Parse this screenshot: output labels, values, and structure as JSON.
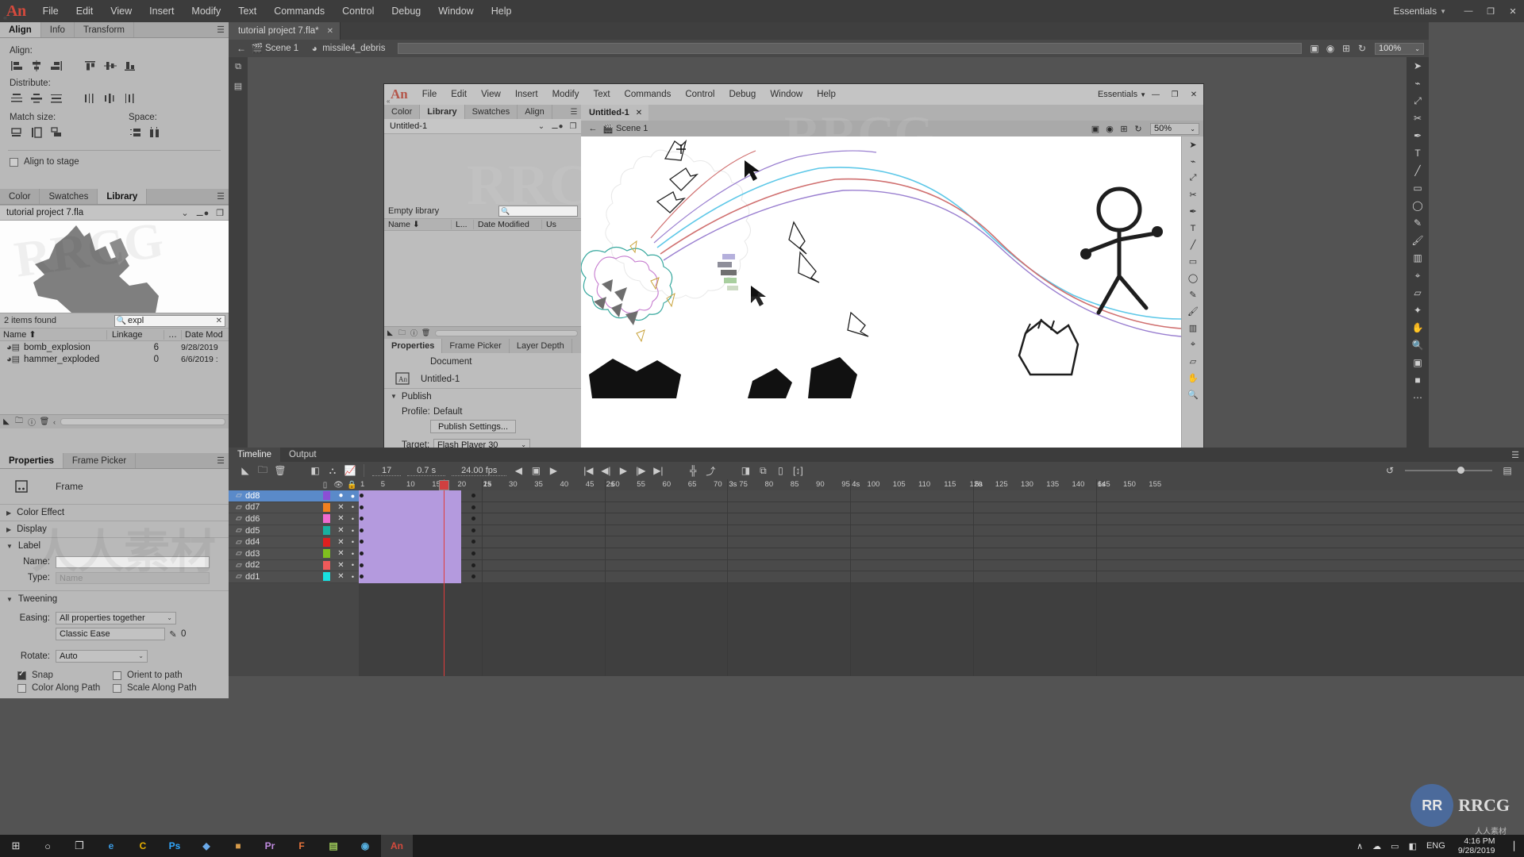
{
  "app": {
    "logo": "An",
    "menus": [
      "File",
      "Edit",
      "View",
      "Insert",
      "Modify",
      "Text",
      "Commands",
      "Control",
      "Debug",
      "Window",
      "Help"
    ],
    "workspace": "Essentials",
    "window_buttons": [
      "—",
      "❐",
      "✕"
    ]
  },
  "left_panels": {
    "top_tabs": [
      {
        "label": "Align",
        "active": true
      },
      {
        "label": "Info",
        "active": false
      },
      {
        "label": "Transform",
        "active": false
      }
    ],
    "align": {
      "align_label": "Align:",
      "distribute_label": "Distribute:",
      "match_size_label": "Match size:",
      "space_label": "Space:",
      "align_to_stage_label": "Align to stage",
      "align_to_stage_checked": false,
      "align_buttons": [
        "align-left",
        "align-horizontal-center",
        "align-right",
        "align-top",
        "align-vertical-center",
        "align-bottom"
      ],
      "distribute_buttons": [
        "distribute-top",
        "distribute-vertical-center",
        "distribute-bottom",
        "distribute-left",
        "distribute-horizontal-center",
        "distribute-right"
      ],
      "match_size_buttons": [
        "match-width",
        "match-height",
        "match-width-and-height"
      ],
      "space_buttons": [
        "space-evenly-vertically",
        "space-evenly-horizontally"
      ]
    },
    "library": {
      "tabs": [
        {
          "label": "Color",
          "active": false
        },
        {
          "label": "Swatches",
          "active": false
        },
        {
          "label": "Library",
          "active": true
        }
      ],
      "file_name": "tutorial project 7.fla",
      "status": "2 items found",
      "search_value": "expl",
      "columns": [
        "Name ⬆",
        "Linkage",
        "…",
        "Date Mod"
      ],
      "items": [
        {
          "name": "bomb_explosion",
          "linkage": "6",
          "date": "9/28/2019"
        },
        {
          "name": "hammer_exploded",
          "linkage": "0",
          "date": "6/6/2019 :"
        }
      ]
    },
    "properties": {
      "tabs": [
        {
          "label": "Properties",
          "active": true
        },
        {
          "label": "Frame Picker",
          "active": false
        }
      ],
      "object_type": "Frame",
      "sections": [
        {
          "label": "Color Effect",
          "open": false
        },
        {
          "label": "Display",
          "open": false
        },
        {
          "label": "Label",
          "open": true
        },
        {
          "label": "Tweening",
          "open": true
        }
      ],
      "label": {
        "name_label": "Name:",
        "name_value": "",
        "type_label": "Type:",
        "type_value": "Name"
      },
      "tweening": {
        "easing_label": "Easing:",
        "easing_value": "All properties together",
        "ease_preset": "Classic Ease",
        "ease_strength": "0",
        "rotate_label": "Rotate:",
        "rotate_value": "Auto",
        "snap_label": "Snap",
        "snap_checked": true,
        "orient_to_path_label": "Orient to path",
        "orient_to_path_checked": false,
        "color_along_path_label": "Color Along Path",
        "color_along_path_checked": false,
        "scale_along_path_label": "Scale Along Path",
        "scale_along_path_checked": false
      }
    }
  },
  "document": {
    "tab_title": "tutorial project 7.fla*",
    "tab_close": "✕",
    "breadcrumb": [
      "Scene 1",
      "missile4_debris"
    ],
    "zoom": "100%"
  },
  "nested_window": {
    "logo": "An",
    "menus": [
      "File",
      "Edit",
      "View",
      "Insert",
      "Modify",
      "Text",
      "Commands",
      "Control",
      "Debug",
      "Window",
      "Help"
    ],
    "workspace": "Essentials",
    "panel_tabs": [
      {
        "label": "Color",
        "active": false
      },
      {
        "label": "Library",
        "active": true
      },
      {
        "label": "Swatches",
        "active": false
      },
      {
        "label": "Align",
        "active": false
      }
    ],
    "library_file": "Untitled-1",
    "library_status": "Empty library",
    "library_columns": [
      "Name ⬇",
      "L...",
      "Date Modified",
      "Us"
    ],
    "properties_tabs": [
      {
        "label": "Properties",
        "active": true
      },
      {
        "label": "Frame Picker",
        "active": false
      },
      {
        "label": "Layer Depth",
        "active": false
      }
    ],
    "properties": {
      "doc_label": "Document",
      "doc_name": "Untitled-1",
      "publish_section": "Publish",
      "profile_label": "Profile:",
      "profile_value": "Default",
      "publish_settings_button": "Publish Settings...",
      "target_label": "Target:",
      "target_value": "Flash Player 30"
    },
    "doc_tab": "Untitled-1",
    "doc_tab_close": "✕",
    "breadcrumb": [
      "Scene 1"
    ],
    "zoom": "50%"
  },
  "timeline": {
    "tabs": [
      {
        "label": "Timeline",
        "active": true
      },
      {
        "label": "Output",
        "active": false
      }
    ],
    "current_frame": "17",
    "elapsed_time": "0.7 s",
    "frame_rate": "24.00 fps",
    "ruler_frames": [
      1,
      5,
      10,
      15,
      20,
      25,
      30,
      35,
      40,
      45,
      50,
      55,
      60,
      65,
      70,
      75,
      80,
      85,
      90,
      95,
      100,
      105,
      110,
      115,
      120,
      125,
      130,
      135,
      140,
      145,
      150,
      155
    ],
    "ruler_seconds": [
      "1s",
      "2s",
      "3s",
      "4s",
      "5s",
      "6s"
    ],
    "layers": [
      {
        "name": "dd8",
        "color": "#8b4fd4",
        "selected": true,
        "visible": true,
        "locked": false,
        "span_start": 1,
        "span_end": 20
      },
      {
        "name": "dd7",
        "color": "#f08020",
        "selected": false,
        "visible": false,
        "locked": false,
        "span_start": 1,
        "span_end": 20
      },
      {
        "name": "dd6",
        "color": "#f06ad0",
        "selected": false,
        "visible": false,
        "locked": false,
        "span_start": 1,
        "span_end": 20
      },
      {
        "name": "dd5",
        "color": "#19b0a0",
        "selected": false,
        "visible": false,
        "locked": false,
        "span_start": 1,
        "span_end": 20
      },
      {
        "name": "dd4",
        "color": "#e01f1f",
        "selected": false,
        "visible": false,
        "locked": false,
        "span_start": 1,
        "span_end": 20
      },
      {
        "name": "dd3",
        "color": "#7fbf1f",
        "selected": false,
        "visible": false,
        "locked": false,
        "span_start": 1,
        "span_end": 20
      },
      {
        "name": "dd2",
        "color": "#f05a5a",
        "selected": false,
        "visible": false,
        "locked": false,
        "span_start": 1,
        "span_end": 20
      },
      {
        "name": "dd1",
        "color": "#18e0e0",
        "selected": false,
        "visible": false,
        "locked": false,
        "span_start": 1,
        "span_end": 20
      }
    ]
  },
  "taskbar": {
    "start": "⊞",
    "search": "○",
    "taskview": "❐",
    "apps": [
      "e",
      "C",
      "Ps",
      "◆",
      "■",
      "Pr",
      "F",
      "▤",
      "◉",
      "An"
    ],
    "tray": [
      "∧",
      "☁",
      "▭",
      "◧"
    ],
    "language": "ENG",
    "time": "4:16 PM",
    "date": "9/28/2019"
  },
  "watermarks": {
    "brand": "RRCG",
    "cn": "人人素材",
    "logo_initials": "RR"
  }
}
